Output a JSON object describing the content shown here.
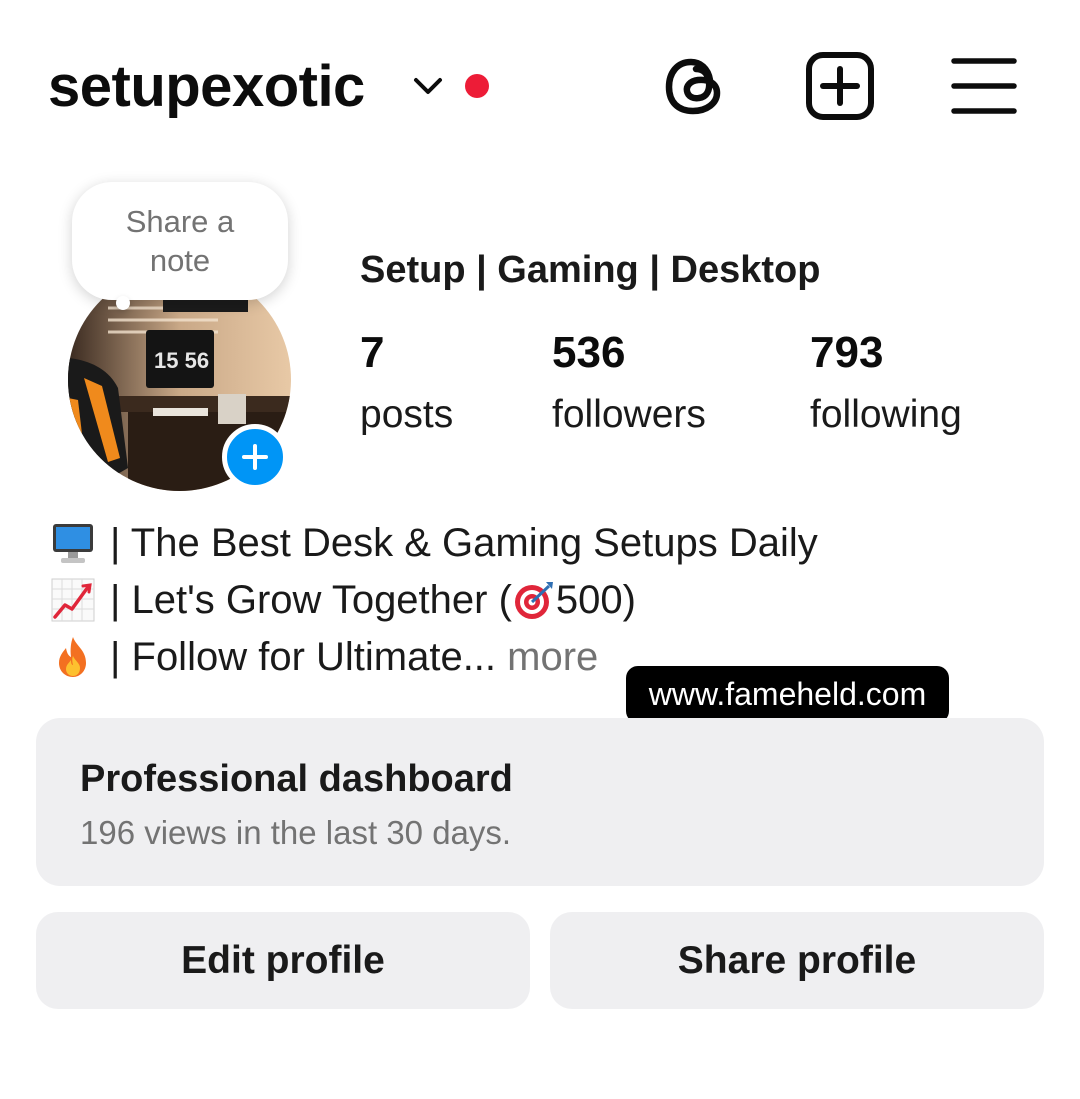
{
  "header": {
    "username": "setupexotic",
    "notification_dot_color": "#ed1c37",
    "icons": [
      "chevron-down-icon",
      "threads-icon",
      "new-post-icon",
      "menu-icon"
    ]
  },
  "note": {
    "text": "Share a note"
  },
  "profile": {
    "category": "Setup | Gaming | Desktop",
    "avatar_clock_text": "15 56",
    "stats": [
      {
        "value": "7",
        "label": "posts"
      },
      {
        "value": "536",
        "label": "followers"
      },
      {
        "value": "793",
        "label": "following"
      }
    ]
  },
  "bio": {
    "lines": [
      {
        "emoji": "desktop-computer-emoji",
        "text": "| The Best Desk & Gaming Setups Daily"
      },
      {
        "emoji": "chart-increasing-emoji",
        "text": "| Let's Grow Together (",
        "inline_emoji": "direct-hit-emoji",
        "text_after": "500)"
      },
      {
        "emoji": "fire-emoji",
        "text": "| Follow for Ultimate...",
        "more": "more"
      }
    ]
  },
  "watermark": "www.fameheld.com",
  "dashboard": {
    "title": "Professional dashboard",
    "subtitle": "196 views in the last 30 days."
  },
  "buttons": {
    "edit": "Edit profile",
    "share": "Share profile"
  },
  "colors": {
    "accent_blue": "#0095f6",
    "button_bg": "#efeff1",
    "muted_text": "#737373"
  }
}
